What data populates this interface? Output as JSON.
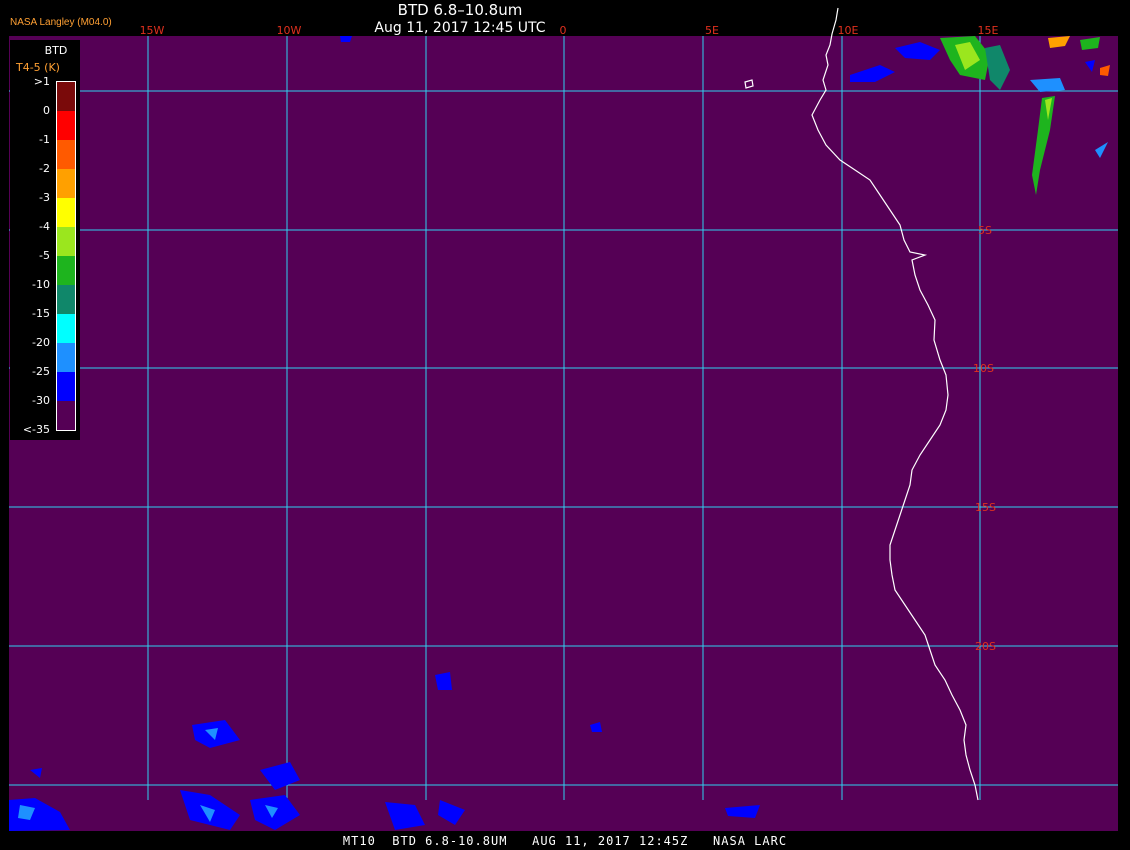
{
  "header": {
    "title": "BTD 6.8–10.8um",
    "subtitle": "Aug 11, 2017 12:45 UTC",
    "credit": "NASA Langley (M04.0)"
  },
  "footer": {
    "text": "MT10  BTD 6.8-10.8UM   AUG 11, 2017 12:45Z   NASA LARC"
  },
  "legend": {
    "title": "BTD",
    "units": "T4-5 (K)",
    "bins": [
      {
        "label": ">1",
        "color": "#7a0a0a"
      },
      {
        "label": "0",
        "color": "#ff0000"
      },
      {
        "label": "-1",
        "color": "#ff5a00"
      },
      {
        "label": "-2",
        "color": "#ffa000"
      },
      {
        "label": "-3",
        "color": "#ffff00"
      },
      {
        "label": "-4",
        "color": "#9be61e"
      },
      {
        "label": "-5",
        "color": "#1eb41e"
      },
      {
        "label": "-10",
        "color": "#10876a"
      },
      {
        "label": "-15",
        "color": "#00ffff"
      },
      {
        "label": "-20",
        "color": "#1e90ff"
      },
      {
        "label": "-25",
        "color": "#0000ff"
      },
      {
        "label": "-30",
        "color": "#550055"
      },
      {
        "label": "<-35",
        "color": "#550055"
      }
    ]
  },
  "map": {
    "background_color": "#550055",
    "grid_color": "#30d0f0",
    "label_color": "#e0301e",
    "coast_color": "#ffffff",
    "lon_labels": [
      "15W",
      "10W",
      "0",
      "5E",
      "10E",
      "15E"
    ],
    "lat_labels": [
      "5S",
      "10S",
      "15S",
      "20S"
    ]
  }
}
